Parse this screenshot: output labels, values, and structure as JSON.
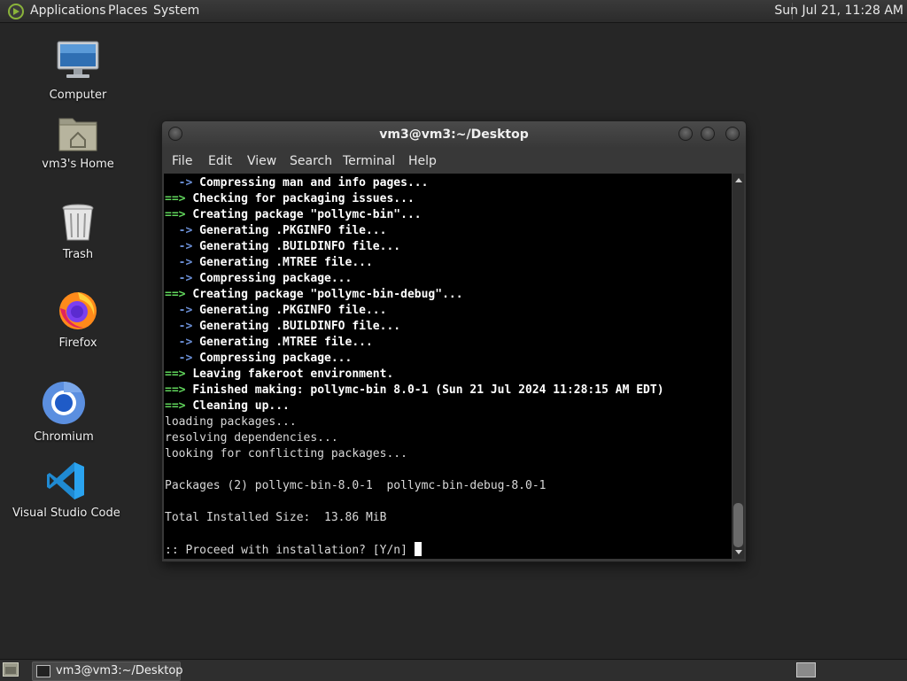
{
  "top_panel": {
    "menus": [
      "Applications",
      "Places",
      "System"
    ],
    "clock": "Sun Jul 21, 11:28 AM"
  },
  "desktop_icons": [
    {
      "label": "Computer",
      "icon": "computer-icon"
    },
    {
      "label": "vm3's Home",
      "icon": "home-folder-icon"
    },
    {
      "label": "Trash",
      "icon": "trash-icon"
    },
    {
      "label": "Firefox",
      "icon": "firefox-icon"
    },
    {
      "label": "Chromium",
      "icon": "chromium-icon"
    },
    {
      "label": "Visual Studio Code",
      "icon": "vscode-icon"
    }
  ],
  "terminal": {
    "title": "vm3@vm3:~/Desktop",
    "menu": [
      "File",
      "Edit",
      "View",
      "Search",
      "Terminal",
      "Help"
    ],
    "lines": [
      {
        "prefix": "  -> ",
        "prefix_type": "arrow-b",
        "text": "Compressing man and info pages...",
        "bold": true
      },
      {
        "prefix": "==> ",
        "prefix_type": "arrow-g",
        "text": "Checking for packaging issues...",
        "bold": true
      },
      {
        "prefix": "==> ",
        "prefix_type": "arrow-g",
        "text": "Creating package \"pollymc-bin\"...",
        "bold": true
      },
      {
        "prefix": "  -> ",
        "prefix_type": "arrow-b",
        "text": "Generating .PKGINFO file...",
        "bold": true
      },
      {
        "prefix": "  -> ",
        "prefix_type": "arrow-b",
        "text": "Generating .BUILDINFO file...",
        "bold": true
      },
      {
        "prefix": "  -> ",
        "prefix_type": "arrow-b",
        "text": "Generating .MTREE file...",
        "bold": true
      },
      {
        "prefix": "  -> ",
        "prefix_type": "arrow-b",
        "text": "Compressing package...",
        "bold": true
      },
      {
        "prefix": "==> ",
        "prefix_type": "arrow-g",
        "text": "Creating package \"pollymc-bin-debug\"...",
        "bold": true
      },
      {
        "prefix": "  -> ",
        "prefix_type": "arrow-b",
        "text": "Generating .PKGINFO file...",
        "bold": true
      },
      {
        "prefix": "  -> ",
        "prefix_type": "arrow-b",
        "text": "Generating .BUILDINFO file...",
        "bold": true
      },
      {
        "prefix": "  -> ",
        "prefix_type": "arrow-b",
        "text": "Generating .MTREE file...",
        "bold": true
      },
      {
        "prefix": "  -> ",
        "prefix_type": "arrow-b",
        "text": "Compressing package...",
        "bold": true
      },
      {
        "prefix": "==> ",
        "prefix_type": "arrow-g",
        "text": "Leaving fakeroot environment.",
        "bold": true
      },
      {
        "prefix": "==> ",
        "prefix_type": "arrow-g",
        "text": "Finished making: pollymc-bin 8.0-1 (Sun 21 Jul 2024 11:28:15 AM EDT)",
        "bold": true
      },
      {
        "prefix": "==> ",
        "prefix_type": "arrow-g",
        "text": "Cleaning up...",
        "bold": true
      },
      {
        "prefix": "",
        "prefix_type": "",
        "text": "loading packages...",
        "bold": false
      },
      {
        "prefix": "",
        "prefix_type": "",
        "text": "resolving dependencies...",
        "bold": false
      },
      {
        "prefix": "",
        "prefix_type": "",
        "text": "looking for conflicting packages...",
        "bold": false
      },
      {
        "prefix": "",
        "prefix_type": "",
        "text": "",
        "bold": false
      },
      {
        "prefix": "",
        "prefix_type": "",
        "text": "Packages (2) pollymc-bin-8.0-1  pollymc-bin-debug-8.0-1",
        "bold": false
      },
      {
        "prefix": "",
        "prefix_type": "",
        "text": "",
        "bold": false
      },
      {
        "prefix": "",
        "prefix_type": "",
        "text": "Total Installed Size:  13.86 MiB",
        "bold": false
      },
      {
        "prefix": "",
        "prefix_type": "",
        "text": "",
        "bold": false
      }
    ],
    "prompt": ":: Proceed with installation? [Y/n] "
  },
  "taskbar": {
    "window_button": "vm3@vm3:~/Desktop"
  }
}
